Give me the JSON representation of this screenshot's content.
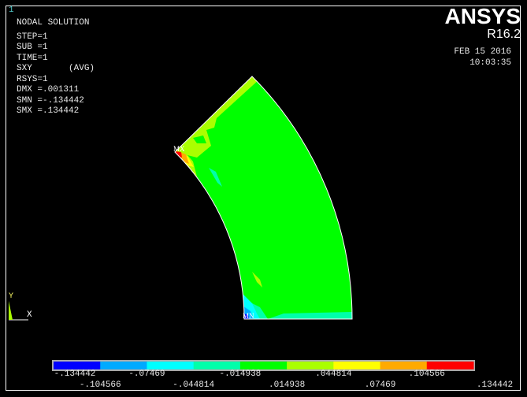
{
  "window_number": "1",
  "header": {
    "title": "NODAL SOLUTION",
    "lines": [
      "STEP=1",
      "SUB =1",
      "TIME=1",
      "SXY       (AVG)",
      "RSYS=1",
      "DMX =.001311",
      "SMN =-.134442",
      "SMX =.134442"
    ]
  },
  "brand": {
    "logo": "ANSYS",
    "version": "R16.2",
    "date": "FEB 15 2016",
    "time": "10:03:35"
  },
  "plot": {
    "max_label": "MX",
    "min_label": "MN",
    "triad_x": "X",
    "triad_y": "Y"
  },
  "legend": {
    "colors": [
      "#0000ff",
      "#00aaff",
      "#00ffff",
      "#00ffaa",
      "#00ff00",
      "#aaff00",
      "#ffff00",
      "#ffaa00",
      "#ff0000"
    ],
    "labels": [
      "-.134442",
      "-.104566",
      "-.07469",
      "-.044814",
      "-.014938",
      ".014938",
      ".044814",
      ".07469",
      ".104566",
      ".134442"
    ]
  }
}
